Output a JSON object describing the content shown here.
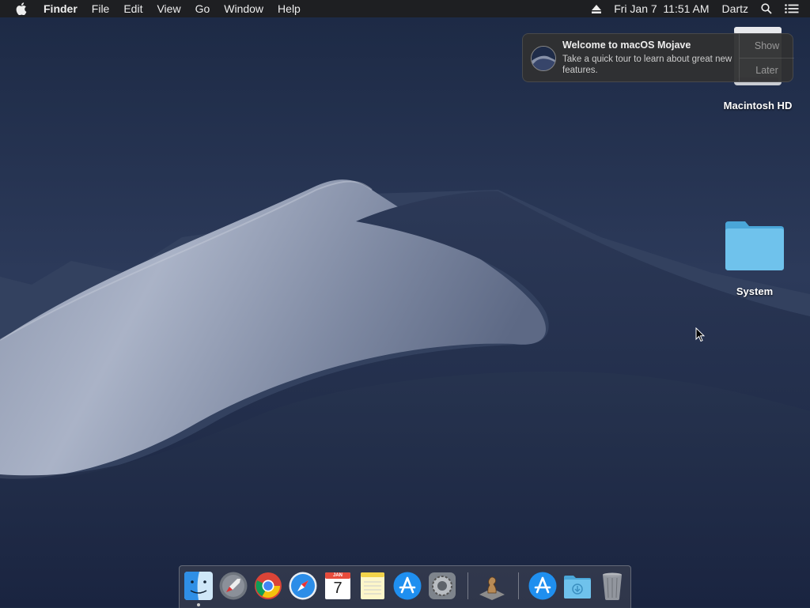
{
  "menubar": {
    "app_name": "Finder",
    "menus": [
      "File",
      "Edit",
      "View",
      "Go",
      "Window",
      "Help"
    ],
    "datetime": "Fri Jan 7  11:51 AM",
    "user": "Dartz"
  },
  "notification": {
    "title": "Welcome to macOS Mojave",
    "body": "Take a quick tour to learn about great new features.",
    "show_label": "Show",
    "later_label": "Later"
  },
  "desktop": {
    "items": [
      {
        "label": "Macintosh HD",
        "icon": "hard-drive-icon"
      },
      {
        "label": "System",
        "icon": "folder-icon"
      }
    ]
  },
  "dock": {
    "apps": [
      {
        "name": "Finder",
        "icon": "finder-icon",
        "running": true
      },
      {
        "name": "Launchpad",
        "icon": "launchpad-icon"
      },
      {
        "name": "Chrome",
        "icon": "chrome-icon"
      },
      {
        "name": "Safari",
        "icon": "safari-icon"
      },
      {
        "name": "Calendar",
        "icon": "calendar-icon",
        "month": "JAN",
        "day": "7"
      },
      {
        "name": "Notes",
        "icon": "notes-icon"
      },
      {
        "name": "App Store",
        "icon": "app-store-icon"
      },
      {
        "name": "System Preferences",
        "icon": "system-preferences-icon"
      },
      {
        "name": "Chess",
        "icon": "chess-icon"
      },
      {
        "name": "Applications",
        "icon": "applications-folder-icon"
      },
      {
        "name": "Downloads",
        "icon": "downloads-folder-icon"
      },
      {
        "name": "Trash",
        "icon": "trash-icon"
      }
    ]
  },
  "colors": {
    "sky": "#1e2d4a",
    "dune_light": "#b7bed0",
    "folder_blue": "#5fb8e6"
  }
}
